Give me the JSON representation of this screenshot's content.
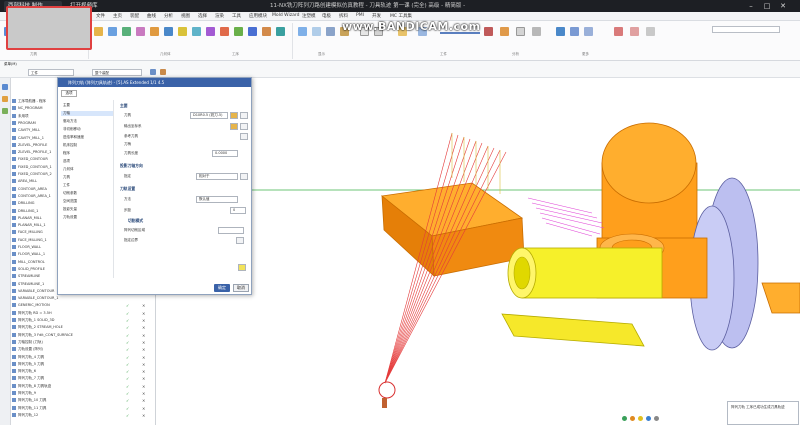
{
  "titlebar": {
    "tab1": "西部科技 制作",
    "tab2": "打开视频库",
    "title": "11-NX铣刀阵列刀路创建模拟仿真教程 - 刀具轨迹 第一课 (完全) 高级 - 精简版 -"
  },
  "watermark": "www.BANDICAM.com",
  "menu": [
    "文件",
    "主页",
    "装配",
    "曲线",
    "分析",
    "视图",
    "选择",
    "渲染",
    "工具",
    "应用模块",
    "Mold Wizard",
    "注塑模",
    "电极",
    "拆料",
    "PMI",
    "开发",
    "MC 工具集"
  ],
  "ribbon_groups": [
    "刀具",
    "几何体",
    "工序",
    "显示",
    "工件",
    "分析",
    "更多"
  ],
  "selbar": {
    "filter": "工件",
    "scope": "整个装配",
    "left_label": "菜单(M)"
  },
  "dialog": {
    "title": "阵列刀轨 (阵列刀具轨迹) - [5].AS Extended 1/1 4.5",
    "small_label": "选项",
    "left_items": [
      "主要",
      "刀轴",
      "驱动方法",
      "非切削移动",
      "进给率和速度",
      "机床控制",
      "程序",
      "选项",
      "几何体",
      "刀具",
      "工件",
      "切削参数",
      "空间范围",
      "投影矢量",
      "刀轨设置"
    ],
    "sections": {
      "main": "主要",
      "tool_axis": "投影刀轴方向",
      "path": "刀轨设置",
      "sub": "切削模式"
    },
    "fields": {
      "tool": "刀具",
      "tool_value": "D10R0.5 (铣刀-5)",
      "output": "输出坐标系",
      "reference": "参考刀具",
      "shank": "刀柄",
      "tool_len": "刀具长度",
      "tool_len_value": "0.0000",
      "axis": "指定",
      "axis_value": "相对于",
      "method": "方法",
      "method_value": "默认值",
      "step": "步距",
      "step_value": "0",
      "pattern": "阵列切削区域",
      "boundary": "指定边界"
    },
    "ok": "确定",
    "cancel": "取消"
  },
  "navigator_rows": [
    "工序导航器 - 程序",
    "NC_PROGRAM",
    "未用项",
    "PROGRAM",
    "CAVITY_MILL",
    "CAVITY_MILL_1",
    "ZLEVEL_PROFILE",
    "ZLEVEL_PROFILE_1",
    "FIXED_CONTOUR",
    "FIXED_CONTOUR_1",
    "FIXED_CONTOUR_2",
    "AREA_MILL",
    "CONTOUR_AREA",
    "CONTOUR_AREA_1",
    "DRILLING",
    "DRILLING_1",
    "PLANAR_MILL",
    "PLANAR_MILL_1",
    "FACE_MILLING",
    "FACE_MILLING_1",
    "FLOOR_WALL",
    "FLOOR_WALL_1",
    "MILL_CONTROL",
    "SOLID_PROFILE",
    "STREAMLINE",
    "STREAMLINE_1",
    "VARIABLE_CONTOUR",
    "VARIABLE_CONTOUR_1",
    "GENERIC_MOTION",
    "阵列刀轨 RD = 3.5H",
    "阵列刀轨_1 SOLID_3D",
    "阵列刀轨_2 STREAM_HOLE",
    "阵列刀轨_3 Fdit_CONT_SURFACE",
    "刀轴控制 (刀轨)",
    "刀轨设置 (阵列)",
    "阵列刀轨_4 刀具",
    "阵列刀轨_5 刀具",
    "阵列刀轨_6",
    "阵列刀轨_7 刀具",
    "阵列刀轨_8 刀具轨迹",
    "阵列刀轨_9",
    "阵列刀轨_10 刀具",
    "阵列刀轨_11 刀具",
    "阵列刀轨_12"
  ],
  "status_popup": "阵列刀轨 工序已成功生成刀具轨迹",
  "colors": {
    "titlebar": "#1d1f24",
    "dialog_header": "#3a62a8",
    "part": "#ffa21f",
    "tube": "#f6f02a",
    "disc": "#bcbff0",
    "toolpath": "#e53b3b",
    "magenta": "#e041d6"
  }
}
